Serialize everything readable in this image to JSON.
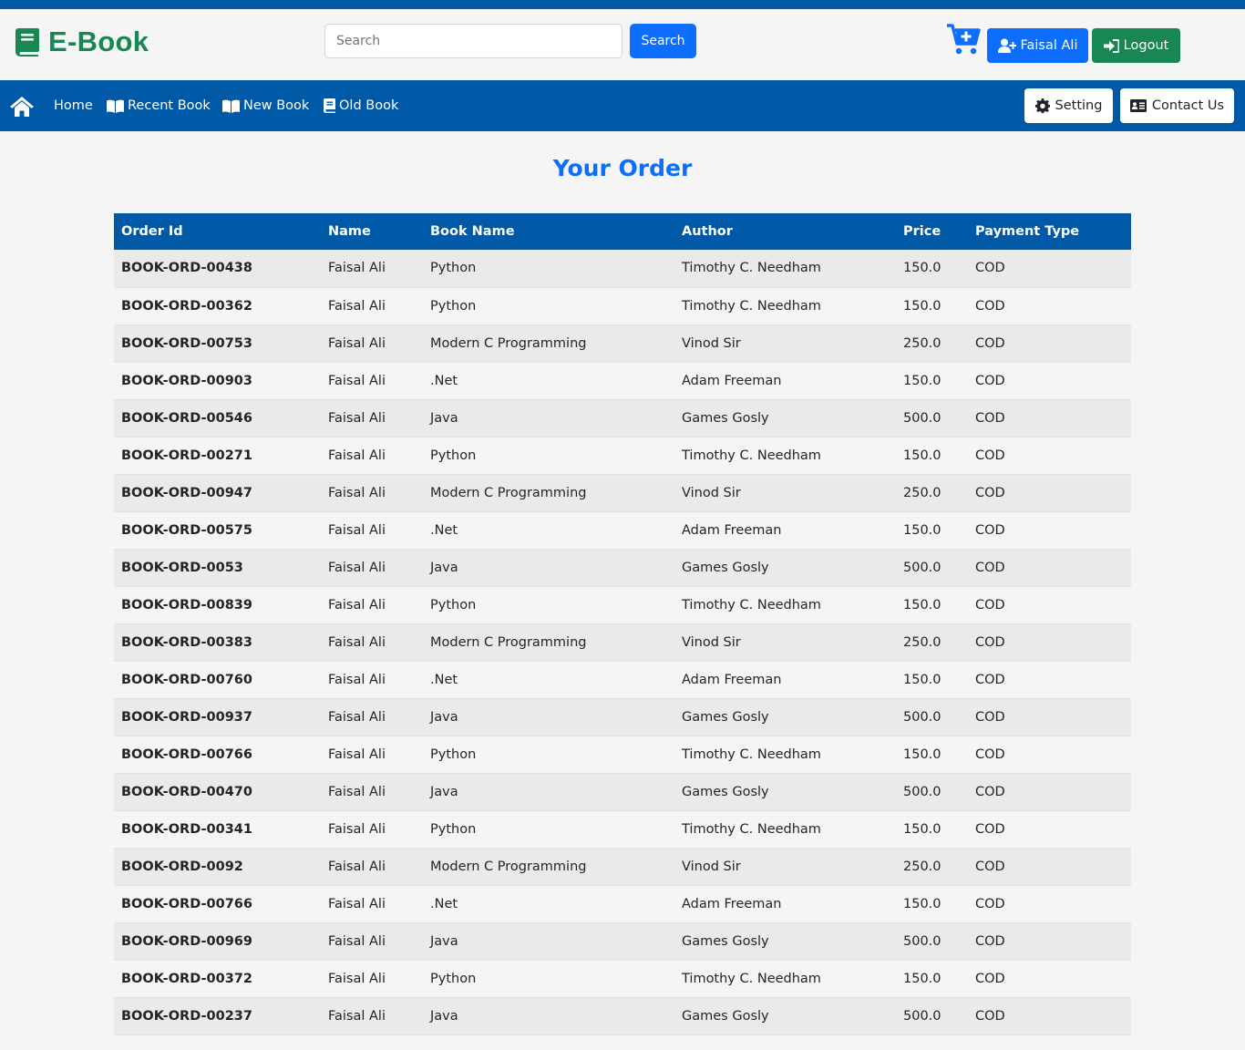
{
  "header": {
    "brand": "E-Book",
    "search_placeholder": "Search",
    "search_button": "Search",
    "user_name": "Faisal Ali",
    "logout_label": "Logout"
  },
  "nav": {
    "home": "Home",
    "recent": "Recent Book",
    "new": "New Book",
    "old": "Old Book",
    "setting": "Setting",
    "contact": "Contact Us"
  },
  "page": {
    "title": "Your Order"
  },
  "table": {
    "headers": [
      "Order Id",
      "Name",
      "Book Name",
      "Author",
      "Price",
      "Payment Type"
    ],
    "rows": [
      [
        "BOOK-ORD-00438",
        "Faisal Ali",
        "Python",
        "Timothy C. Needham",
        "150.0",
        "COD"
      ],
      [
        "BOOK-ORD-00362",
        "Faisal Ali",
        "Python",
        "Timothy C. Needham",
        "150.0",
        "COD"
      ],
      [
        "BOOK-ORD-00753",
        "Faisal Ali",
        "Modern C Programming",
        "Vinod Sir",
        "250.0",
        "COD"
      ],
      [
        "BOOK-ORD-00903",
        "Faisal Ali",
        ".Net",
        "Adam Freeman",
        "150.0",
        "COD"
      ],
      [
        "BOOK-ORD-00546",
        "Faisal Ali",
        "Java",
        "Games Gosly",
        "500.0",
        "COD"
      ],
      [
        "BOOK-ORD-00271",
        "Faisal Ali",
        "Python",
        "Timothy C. Needham",
        "150.0",
        "COD"
      ],
      [
        "BOOK-ORD-00947",
        "Faisal Ali",
        "Modern C Programming",
        "Vinod Sir",
        "250.0",
        "COD"
      ],
      [
        "BOOK-ORD-00575",
        "Faisal Ali",
        ".Net",
        "Adam Freeman",
        "150.0",
        "COD"
      ],
      [
        "BOOK-ORD-0053",
        "Faisal Ali",
        "Java",
        "Games Gosly",
        "500.0",
        "COD"
      ],
      [
        "BOOK-ORD-00839",
        "Faisal Ali",
        "Python",
        "Timothy C. Needham",
        "150.0",
        "COD"
      ],
      [
        "BOOK-ORD-00383",
        "Faisal Ali",
        "Modern C Programming",
        "Vinod Sir",
        "250.0",
        "COD"
      ],
      [
        "BOOK-ORD-00760",
        "Faisal Ali",
        ".Net",
        "Adam Freeman",
        "150.0",
        "COD"
      ],
      [
        "BOOK-ORD-00937",
        "Faisal Ali",
        "Java",
        "Games Gosly",
        "500.0",
        "COD"
      ],
      [
        "BOOK-ORD-00766",
        "Faisal Ali",
        "Python",
        "Timothy C. Needham",
        "150.0",
        "COD"
      ],
      [
        "BOOK-ORD-00470",
        "Faisal Ali",
        "Java",
        "Games Gosly",
        "500.0",
        "COD"
      ],
      [
        "BOOK-ORD-00341",
        "Faisal Ali",
        "Python",
        "Timothy C. Needham",
        "150.0",
        "COD"
      ],
      [
        "BOOK-ORD-0092",
        "Faisal Ali",
        "Modern C Programming",
        "Vinod Sir",
        "250.0",
        "COD"
      ],
      [
        "BOOK-ORD-00766",
        "Faisal Ali",
        ".Net",
        "Adam Freeman",
        "150.0",
        "COD"
      ],
      [
        "BOOK-ORD-00969",
        "Faisal Ali",
        "Java",
        "Games Gosly",
        "500.0",
        "COD"
      ],
      [
        "BOOK-ORD-00372",
        "Faisal Ali",
        "Python",
        "Timothy C. Needham",
        "150.0",
        "COD"
      ],
      [
        "BOOK-ORD-00237",
        "Faisal Ali",
        "Java",
        "Games Gosly",
        "500.0",
        "COD"
      ]
    ]
  },
  "colors": {
    "brand_green": "#198754",
    "nav_blue": "#0059a6",
    "primary": "#0d6efd"
  },
  "icons": {
    "brand": "book-icon",
    "cart": "cart-plus-icon",
    "user": "user-plus-icon",
    "logout": "sign-in-icon",
    "home": "home-icon",
    "recent": "book-open-icon",
    "new": "book-open-icon",
    "old": "book-icon",
    "setting": "gear-icon",
    "contact": "id-card-icon"
  }
}
